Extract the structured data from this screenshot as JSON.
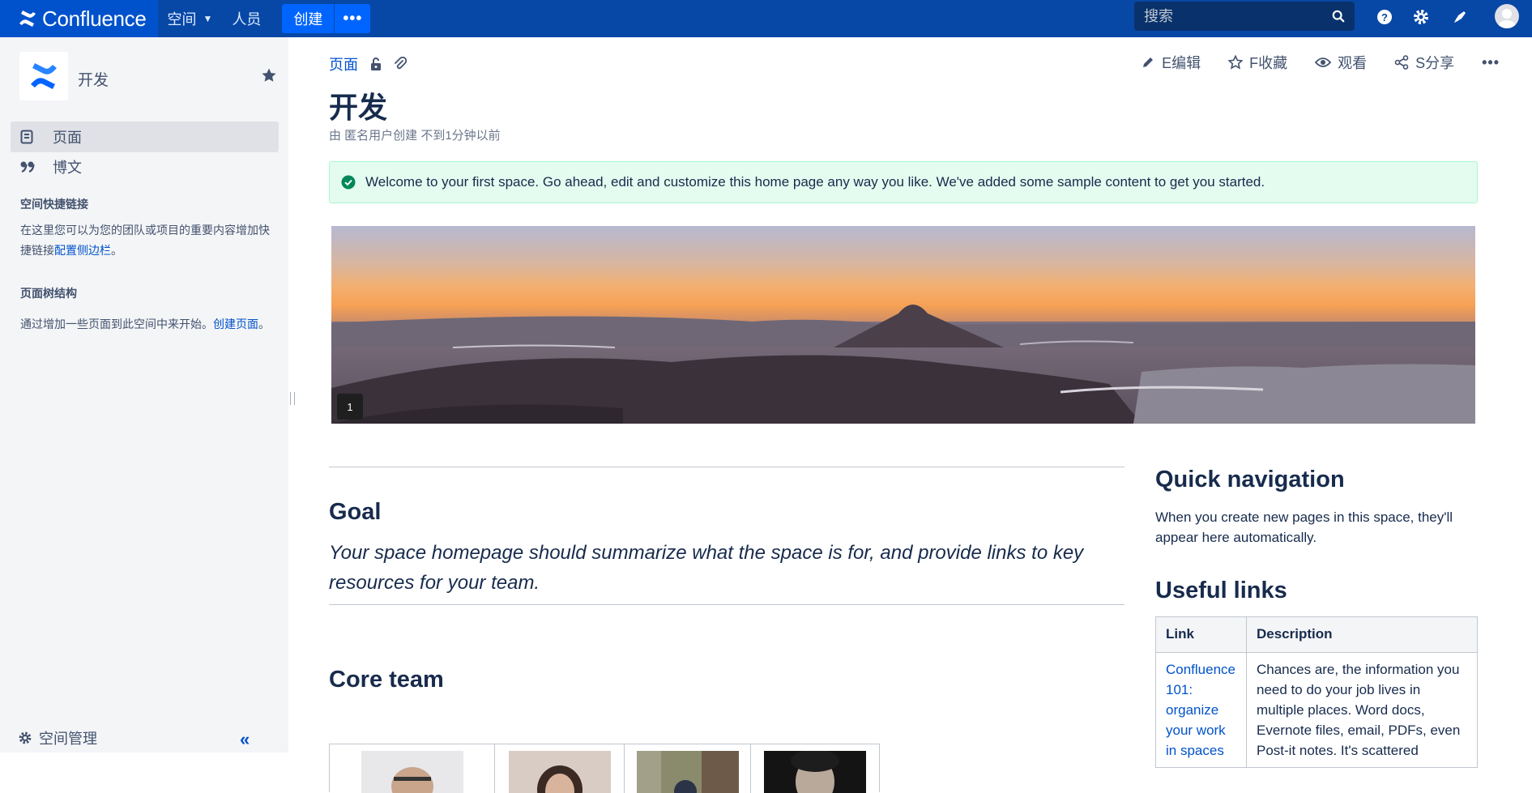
{
  "topbar": {
    "app_name": "Confluence",
    "nav": [
      "空间",
      "人员"
    ],
    "create_label": "创建",
    "more_label": "•••",
    "search_placeholder": "搜索",
    "icons": [
      "help-icon",
      "settings-icon",
      "notifications-icon",
      "user-avatar"
    ]
  },
  "sidebar": {
    "space_name": "开发",
    "nav_items": [
      {
        "label": "页面",
        "icon": "page-icon",
        "active": true
      },
      {
        "label": "博文",
        "icon": "quote-icon",
        "active": false
      }
    ],
    "shortcuts_heading": "空间快捷链接",
    "shortcuts_text": "在这里您可以为您的团队或项目的重要内容增加快捷链接",
    "shortcuts_link": "配置侧边栏",
    "shortcuts_end": "。",
    "tree_heading": "页面树结构",
    "tree_text": "通过增加一些页面到此空间中来开始。",
    "tree_link": "创建页面",
    "tree_end": "。",
    "footer_label": "空间管理",
    "collapse_label": "«"
  },
  "page": {
    "breadcrumb": "页面",
    "actions": {
      "edit": "E编辑",
      "favorite": "F收藏",
      "watch": "观看",
      "share": "S分享",
      "more": "•••"
    },
    "title": "开发",
    "byline": "由 匿名用户创建 不到1分钟以前",
    "banner": "Welcome to your first space. Go ahead, edit and customize this home page any way you like. We've added some sample content to get you started.",
    "hero_comment_count": "1",
    "goal_heading": "Goal",
    "goal_text": "Your space homepage should summarize what the space is for, and provide links to key resources for your team.",
    "core_team_heading": "Core team",
    "quick_nav_heading": "Quick navigation",
    "quick_nav_text": "When you create new pages in this space, they'll appear here automatically.",
    "useful_links_heading": "Useful links",
    "links_table": {
      "headers": [
        "Link",
        "Description"
      ],
      "rows": [
        {
          "link": "Confluence 101: organize your work in spaces",
          "description": "Chances are, the information you need to do your job lives in multiple places. Word docs, Evernote files, email, PDFs, even Post-it notes. It's scattered"
        }
      ]
    }
  }
}
